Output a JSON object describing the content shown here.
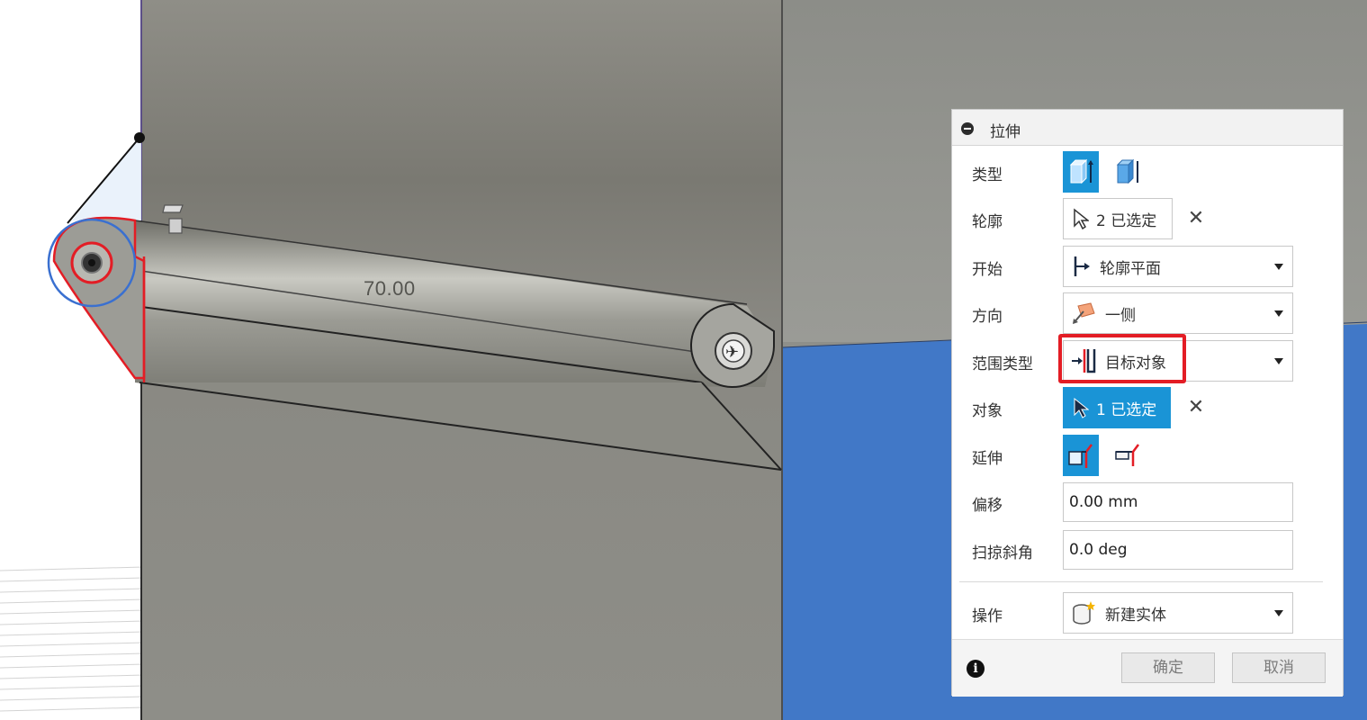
{
  "viewport": {
    "dimension_value": "70.00",
    "colors": {
      "body": "#8a8a82",
      "selected_face": "#4178c7",
      "sketch_red": "#e31d25",
      "sketch_blue": "#3a70d0"
    }
  },
  "panel": {
    "title": "拉伸",
    "rows": {
      "type": {
        "label": "类型"
      },
      "profile": {
        "label": "轮廓",
        "value": "2 已选定"
      },
      "start": {
        "label": "开始",
        "value": "轮廓平面"
      },
      "direction": {
        "label": "方向",
        "value": "一侧"
      },
      "extent_type": {
        "label": "范围类型",
        "value": "目标对象"
      },
      "object": {
        "label": "对象",
        "value": "1 已选定"
      },
      "extend": {
        "label": "延伸"
      },
      "offset": {
        "label": "偏移",
        "value": "0.00 mm"
      },
      "taper_angle": {
        "label": "扫掠斜角",
        "value": "0.0 deg"
      },
      "operation": {
        "label": "操作",
        "value": "新建实体"
      }
    },
    "footer": {
      "ok_label": "确定",
      "cancel_label": "取消"
    },
    "accent_color": "#1a94d6",
    "highlight_color": "#e31d25"
  }
}
